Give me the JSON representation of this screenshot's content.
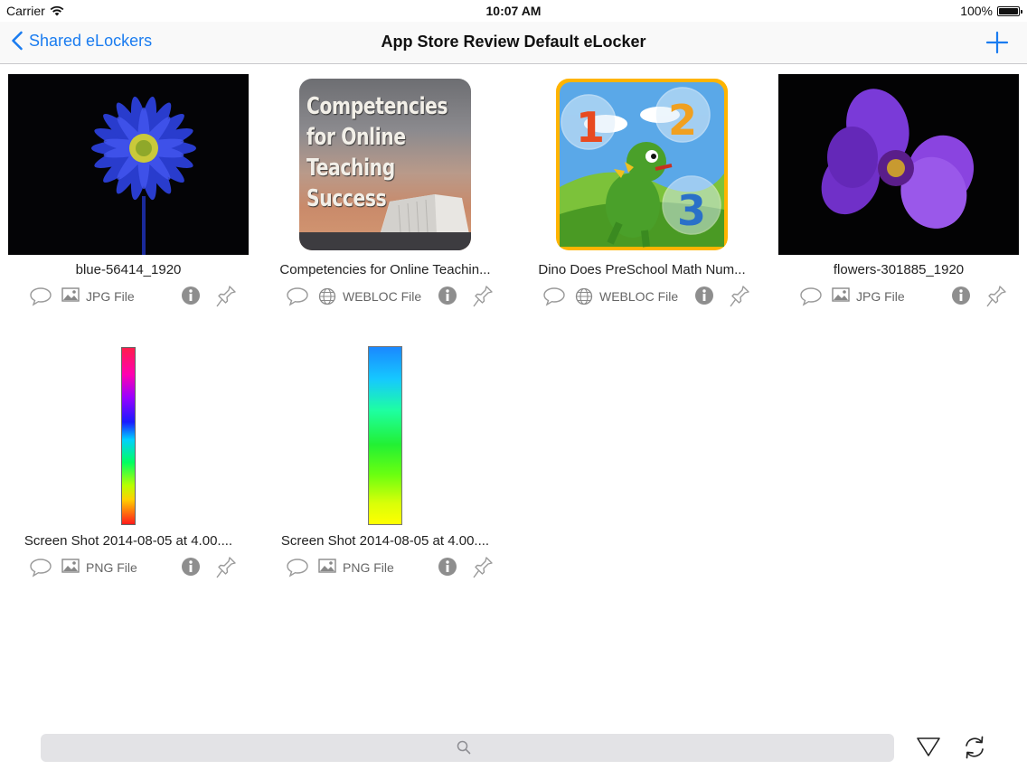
{
  "status_bar": {
    "carrier": "Carrier",
    "time": "10:07 AM",
    "battery": "100%"
  },
  "nav": {
    "back_label": "Shared eLockers",
    "title": "App Store Review Default eLocker"
  },
  "book_cover_text": "Competencies for Online Teaching Success",
  "files": [
    {
      "name": "blue-56414_1920",
      "type": "JPG File",
      "type_icon": "image-icon"
    },
    {
      "name": "Competencies for Online Teachin...",
      "type": "WEBLOC File",
      "type_icon": "globe-icon"
    },
    {
      "name": "Dino Does PreSchool Math Num...",
      "type": "WEBLOC File",
      "type_icon": "globe-icon"
    },
    {
      "name": "flowers-301885_1920",
      "type": "JPG File",
      "type_icon": "image-icon"
    },
    {
      "name": "Screen Shot 2014-08-05 at 4.00....",
      "type": "PNG File",
      "type_icon": "image-icon"
    },
    {
      "name": "Screen Shot 2014-08-05 at 4.00....",
      "type": "PNG File",
      "type_icon": "image-icon"
    }
  ],
  "colors": {
    "accent": "#1a7cf0",
    "icon_gray": "#9a9a9a",
    "search_bg": "#e3e3e6"
  }
}
